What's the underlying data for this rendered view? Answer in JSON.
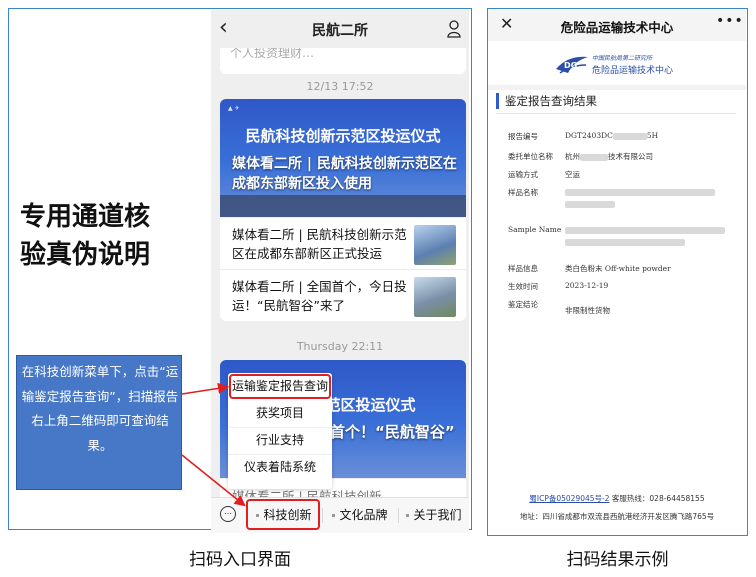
{
  "left": {
    "headline_line1": "专用通道核",
    "headline_line2": "验真伪说明",
    "phone": {
      "title": "民航二所",
      "prev_card_text": "个人投资理财…",
      "timestamp_1": "12/13 17:52",
      "card1": {
        "banner_title": "民航科技创新示范区投运仪式",
        "banner_headline": "媒体看二所 | 民航科技创新示范区在成都东部新区投入使用",
        "items": [
          {
            "text": "媒体看二所 | 民航科技创新示范区在成都东部新区正式投运"
          },
          {
            "text": "媒体看二所 | 全国首个，今日投运！“民航智谷”来了"
          }
        ]
      },
      "timestamp_2": "Thursday 22:11",
      "card2": {
        "banner_title": "示范区投运仪式",
        "banner_headline": "首个！“民航智谷”",
        "bottom_text": "媒体看二所 | 民航科技创新"
      },
      "menu": {
        "items": [
          "运输鉴定报告查询",
          "获奖项目",
          "行业支持",
          "仪表着陆系统"
        ]
      },
      "bottom_bar": {
        "buttons": [
          "科技创新",
          "文化品牌",
          "关于我们"
        ]
      }
    },
    "callout_text": "在科技创新菜单下，点击“运输鉴定报告查询”，扫描报告右上角二维码即可查询结果。"
  },
  "right": {
    "title": "危险品运输技术中心",
    "logo_cn": "中国民航局第二研究所",
    "logo_name": "危险品运输技术中心",
    "section_title": "鉴定报告查询结果",
    "fields": [
      {
        "label": "报告编号",
        "value": "DGT2403DC",
        "suffix": "5H"
      },
      {
        "label": "委托单位名称",
        "value": "杭州",
        "suffix": "技术有限公司"
      },
      {
        "label": "运输方式",
        "value": "空运",
        "suffix": ""
      },
      {
        "label": "样品名称",
        "value": "",
        "suffix": ""
      },
      {
        "label": "Sample Name",
        "value": "",
        "suffix": ""
      },
      {
        "label": "样品信息",
        "value": "类白色粉末 Off-white powder",
        "suffix": ""
      },
      {
        "label": "生效时间",
        "value": "2023-12-19",
        "suffix": ""
      },
      {
        "label": "鉴定结论",
        "value": "非限制性货物",
        "suffix": ""
      }
    ],
    "footer_icp_link": "蜀ICP备05029045号-2",
    "footer_hotline": "客服热线：028-64458155",
    "footer_address": "地址：四川省成都市双流县西航港经济开发区腾飞路765号"
  },
  "captions": {
    "left": "扫码入口界面",
    "right": "扫码结果示例"
  },
  "colors": {
    "frame_blue": "#3c83c8",
    "callout_blue": "#4778c7",
    "highlight_red": "#e02020",
    "accent_blue": "#2f5ccc"
  },
  "icons": [
    "chevron-left-icon",
    "user-icon",
    "keyboard-icon",
    "close-icon",
    "more-icon",
    "logo-icon"
  ]
}
